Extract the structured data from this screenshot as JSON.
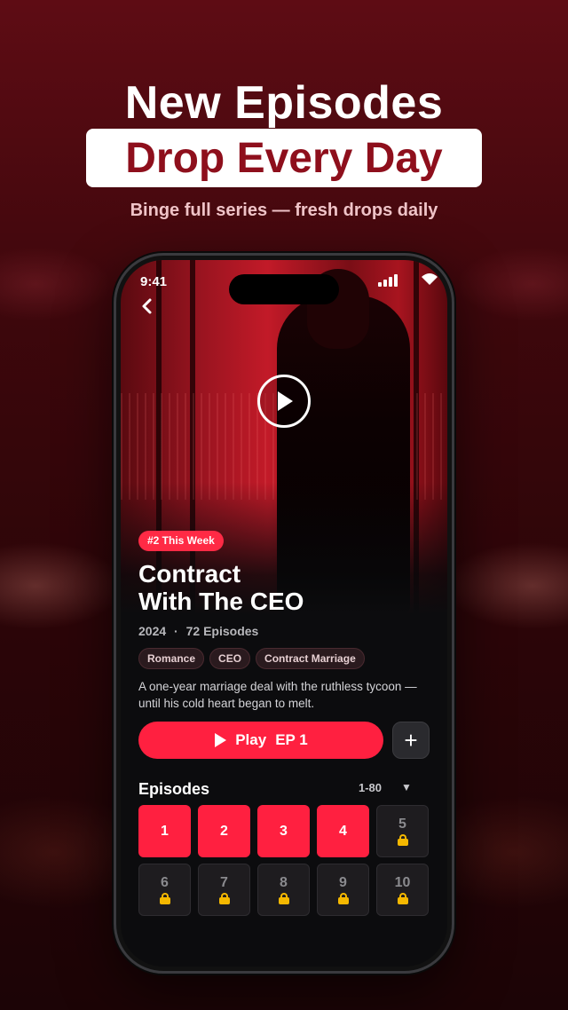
{
  "promo": {
    "headline": "New Episodes",
    "banner": "Drop Every Day",
    "subhead": "Binge full series — fresh drops daily"
  },
  "status_bar": {
    "time": "9:41"
  },
  "show": {
    "rank_badge": "#2 This Week",
    "title_line1": "Contract",
    "title_line2": "With The CEO",
    "year": "2024",
    "separator": "·",
    "episodes_count": "72 Episodes",
    "tags": [
      "Romance",
      "CEO",
      "Contract Marriage"
    ],
    "description": "A one-year marriage deal with the ruthless tycoon — until his cold heart began to melt."
  },
  "actions": {
    "play_label": "Play",
    "play_episode": "EP 1",
    "add_label": "+"
  },
  "episodes": {
    "heading": "Episodes",
    "range": "1-80",
    "range_caret": "▼",
    "items": [
      {
        "num": "1",
        "locked": false
      },
      {
        "num": "2",
        "locked": false
      },
      {
        "num": "3",
        "locked": false
      },
      {
        "num": "4",
        "locked": false
      },
      {
        "num": "5",
        "locked": true
      },
      {
        "num": "6",
        "locked": true
      },
      {
        "num": "7",
        "locked": true
      },
      {
        "num": "8",
        "locked": true
      },
      {
        "num": "9",
        "locked": true
      },
      {
        "num": "10",
        "locked": true
      }
    ]
  },
  "colors": {
    "accent": "#ff2040",
    "banner_text": "#8e0f1c",
    "lock": "#f5b800"
  },
  "icons": {
    "back": "chevron-left-icon",
    "play": "play-icon",
    "lock": "lock-icon",
    "add": "plus-icon"
  }
}
